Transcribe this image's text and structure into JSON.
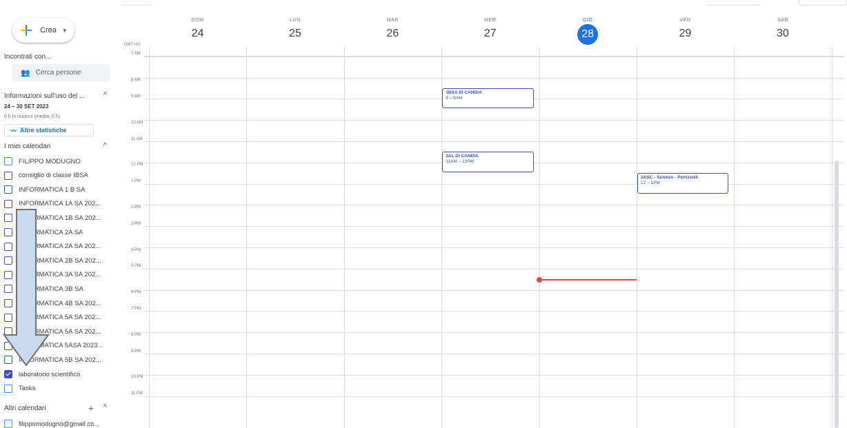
{
  "create_label": "Crea",
  "timezone": "GMT+02",
  "meet_with": {
    "title": "Incontrati con...",
    "search_placeholder": "Cerca persone"
  },
  "usage": {
    "title": "Informazioni sull'uso del ...",
    "range": "24 – 30 SET 2023",
    "meetings": "0 h in riunioni (media: 0 h)",
    "stats_button": "Altre statistiche"
  },
  "my_calendars": {
    "title": "I miei calendari",
    "items": [
      {
        "label": "FILIPPO MODUGNO",
        "color": "#4285f4",
        "checked": false
      },
      {
        "label": "consiglio di classe IBSA",
        "color": "#3f51b5",
        "checked": false
      },
      {
        "label": "INFORMATICA 1 B SA",
        "color": "#0b8043",
        "checked": false
      },
      {
        "label": "INFORMATICA 1A SA 202...",
        "color": "#3f51b5",
        "checked": false
      },
      {
        "label": "INFORMATICA 1B SA 202...",
        "color": "#3f51b5",
        "checked": false
      },
      {
        "label": "INFORMATICA 2A SA",
        "color": "#3f51b5",
        "checked": false
      },
      {
        "label": "INFORMATICA 2A SA 202...",
        "color": "#3f51b5",
        "checked": false
      },
      {
        "label": "INFORMATICA 2B SA 202...",
        "color": "#3f51b5",
        "checked": false
      },
      {
        "label": "INFORMATICA 3A SA 202...",
        "color": "#3f51b5",
        "checked": false
      },
      {
        "label": "INFORMATICA 3B SA",
        "color": "#3f51b5",
        "checked": false
      },
      {
        "label": "INFORMATICA 4B SA 202...",
        "color": "#3f51b5",
        "checked": false
      },
      {
        "label": "INFORMATICA 5A SA 202...",
        "color": "#3f51b5",
        "checked": false
      },
      {
        "label": "INFORMATICA 5A SA 202...",
        "color": "#3f51b5",
        "checked": false
      },
      {
        "label": "INFORMATICA 5ASA 2023...",
        "color": "#3f51b5",
        "checked": false
      },
      {
        "label": "INFORMATICA 5B SA 202...",
        "color": "#0b8043",
        "checked": false
      },
      {
        "label": "laboratorio scientifico",
        "color": "#3f51b5",
        "checked": true
      },
      {
        "label": "Tasks",
        "color": "#4285f4",
        "checked": false
      }
    ]
  },
  "other_calendars": {
    "title": "Altri calendari",
    "items": [
      {
        "label": "filippomodugno@gmail.co...",
        "color": "#4285f4",
        "checked": false
      }
    ]
  },
  "days": [
    {
      "name": "DOM",
      "num": "24",
      "today": false
    },
    {
      "name": "LUN",
      "num": "25",
      "today": false
    },
    {
      "name": "MAR",
      "num": "26",
      "today": false
    },
    {
      "name": "MER",
      "num": "27",
      "today": false
    },
    {
      "name": "GIO",
      "num": "28",
      "today": true
    },
    {
      "name": "VEN",
      "num": "29",
      "today": false
    },
    {
      "name": "SAB",
      "num": "30",
      "today": false
    }
  ],
  "hours": [
    "7 AM",
    "8 AM",
    "9 AM",
    "10 AM",
    "11 AM",
    "12 PM",
    "1 PM",
    "2 PM",
    "3 PM",
    "4 PM",
    "5 PM",
    "6 PM",
    "7 PM",
    "8 PM",
    "9 PM",
    "10 PM",
    "11 PM"
  ],
  "events": [
    {
      "title": "1BSA DI CANDIA",
      "time": "8 – 9AM",
      "day": 3,
      "start": 8,
      "end": 9
    },
    {
      "title": "3AL DI CANDIA",
      "time": "11AM – 12PM",
      "day": 3,
      "start": 11,
      "end": 12
    },
    {
      "title": "2ASC - Scienze - Petrizzelli",
      "time": "12 – 1PM",
      "day": 5,
      "start": 12,
      "end": 13
    }
  ],
  "current_time": {
    "day": 4,
    "hour": 17.05
  }
}
